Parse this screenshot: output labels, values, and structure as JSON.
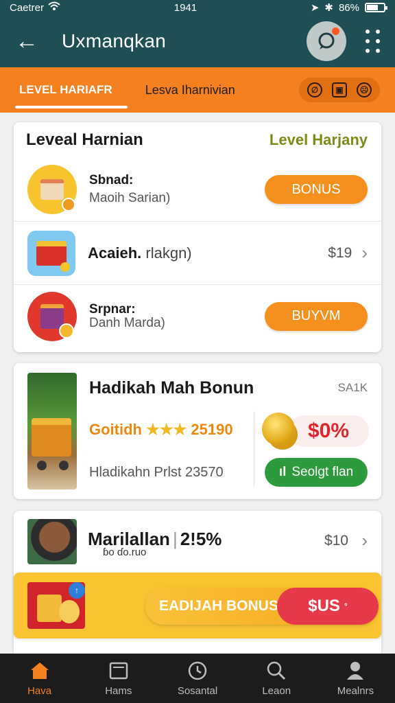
{
  "status_bar": {
    "carrier": "Caetrer",
    "time": "1941",
    "battery": "86%"
  },
  "app_bar": {
    "title": "Uxmanqkan"
  },
  "tabs": {
    "active": "LEVEL HARIAFR",
    "second": "Lesva Iharnivian"
  },
  "level_card": {
    "title": "Leveal Harnian",
    "right_title": "Level Harjany",
    "rows": [
      {
        "title": "Sbnad:",
        "subtitle": "Maoih Sarian)",
        "button": "BONUS"
      },
      {
        "title": "Acaieh.",
        "subtitle": "rlakgn)",
        "price": "$19"
      },
      {
        "title": "Srpnar:",
        "subtitle": "Danh Marda)",
        "button": "BUYVM"
      }
    ]
  },
  "offer_card": {
    "title": "Hadikah Mah Bonun",
    "code": "SA1K",
    "gold_label": "Goitidh",
    "rating_value": "25190",
    "percent": "$0%",
    "subtitle": "Hladikahn Prlst 23570",
    "action_button": "Seolgt flan"
  },
  "item_card": {
    "name": "Marilallan",
    "value": "2!5%",
    "strike_text": "ɓo ɗo.ruo",
    "price": "$10"
  },
  "banner": {
    "label": "EADIJAH BONUS",
    "price": "$US",
    "badge": "↑"
  },
  "bottom_nav": [
    {
      "label": "Hava",
      "active": true
    },
    {
      "label": "Hams",
      "active": false
    },
    {
      "label": "Sosantal",
      "active": false
    },
    {
      "label": "Leaon",
      "active": false
    },
    {
      "label": "Mealnrs",
      "active": false
    }
  ]
}
